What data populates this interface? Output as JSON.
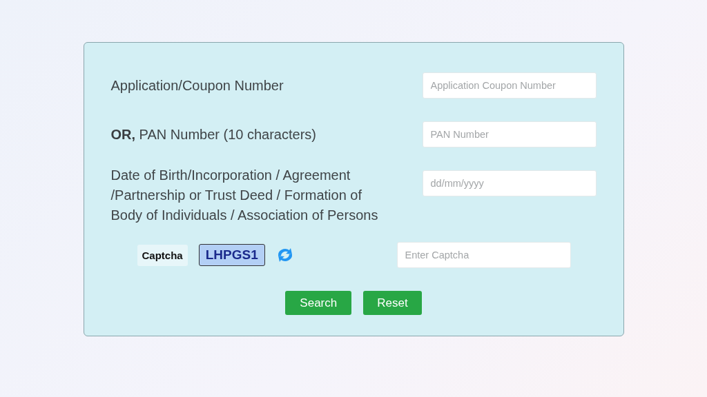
{
  "fields": [
    {
      "label": "Application/Coupon Number",
      "placeholder": "Application Coupon Number"
    },
    {
      "label": "**OR,** PAN Number (10 characters)",
      "placeholder": "PAN Number"
    },
    {
      "label": "Date of Birth/Incorporation / Agreement /Partnership or Trust Deed / Formation of Body of Individuals / Association of Persons",
      "placeholder": "dd/mm/yyyy"
    }
  ],
  "captcha": {
    "label": "Captcha",
    "code": "LHPGS1",
    "placeholder": "Enter Captcha"
  },
  "buttons": [
    "Search",
    "Reset"
  ]
}
